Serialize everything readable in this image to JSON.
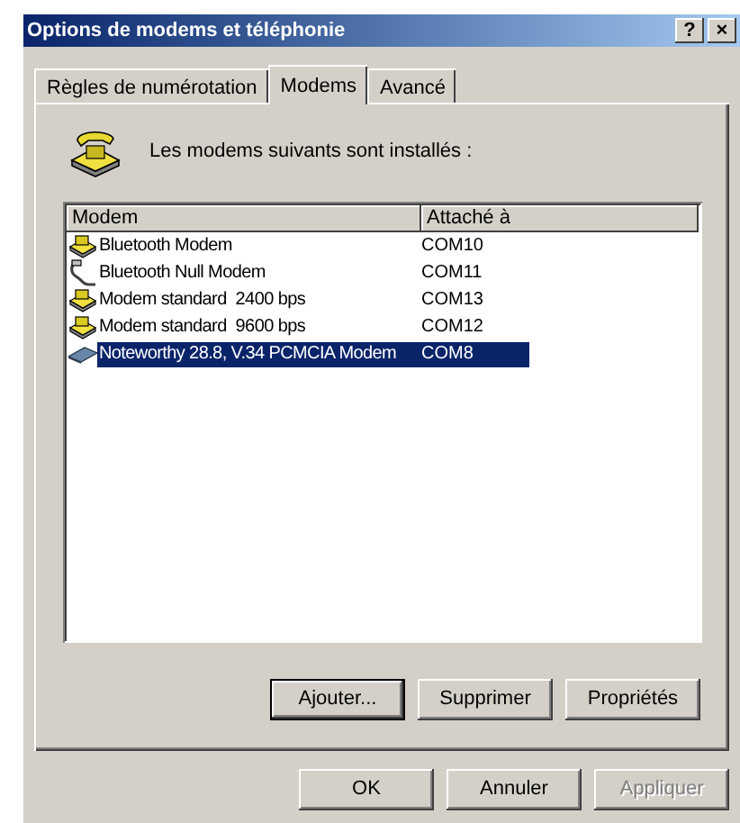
{
  "window": {
    "title": "Options de modems et téléphonie",
    "title_buttons": [
      "?",
      "×"
    ]
  },
  "tabs": [
    {
      "label": "Règles de numérotation",
      "selected": false
    },
    {
      "label": "Modems",
      "selected": true
    },
    {
      "label": "Avancé",
      "selected": false
    }
  ],
  "intro": "Les modems suivants sont installés :",
  "table": {
    "columns": [
      "Modem",
      "Attaché à"
    ],
    "rows": [
      {
        "kind": "modem",
        "name": "Bluetooth Modem",
        "port": "COM10",
        "selected": false
      },
      {
        "kind": "cable",
        "name": "Bluetooth Null Modem",
        "port": "COM11",
        "selected": false
      },
      {
        "kind": "modem",
        "name": "Modem standard  2400 bps",
        "port": "COM13",
        "selected": false
      },
      {
        "kind": "modem",
        "name": "Modem standard  9600 bps",
        "port": "COM12",
        "selected": false
      },
      {
        "kind": "card",
        "name": "Noteworthy 28.8, V.34 PCMCIA Modem",
        "port": "COM8",
        "selected": true
      }
    ]
  },
  "panel_buttons": [
    {
      "label": "Ajouter...",
      "default": true,
      "disabled": false
    },
    {
      "label": "Supprimer",
      "default": false,
      "disabled": false
    },
    {
      "label": "Propriétés",
      "default": false,
      "disabled": false
    }
  ],
  "dialog_buttons": [
    {
      "label": "OK",
      "default": false,
      "disabled": false
    },
    {
      "label": "Annuler",
      "default": false,
      "disabled": false
    },
    {
      "label": "Appliquer",
      "default": false,
      "disabled": true
    }
  ]
}
